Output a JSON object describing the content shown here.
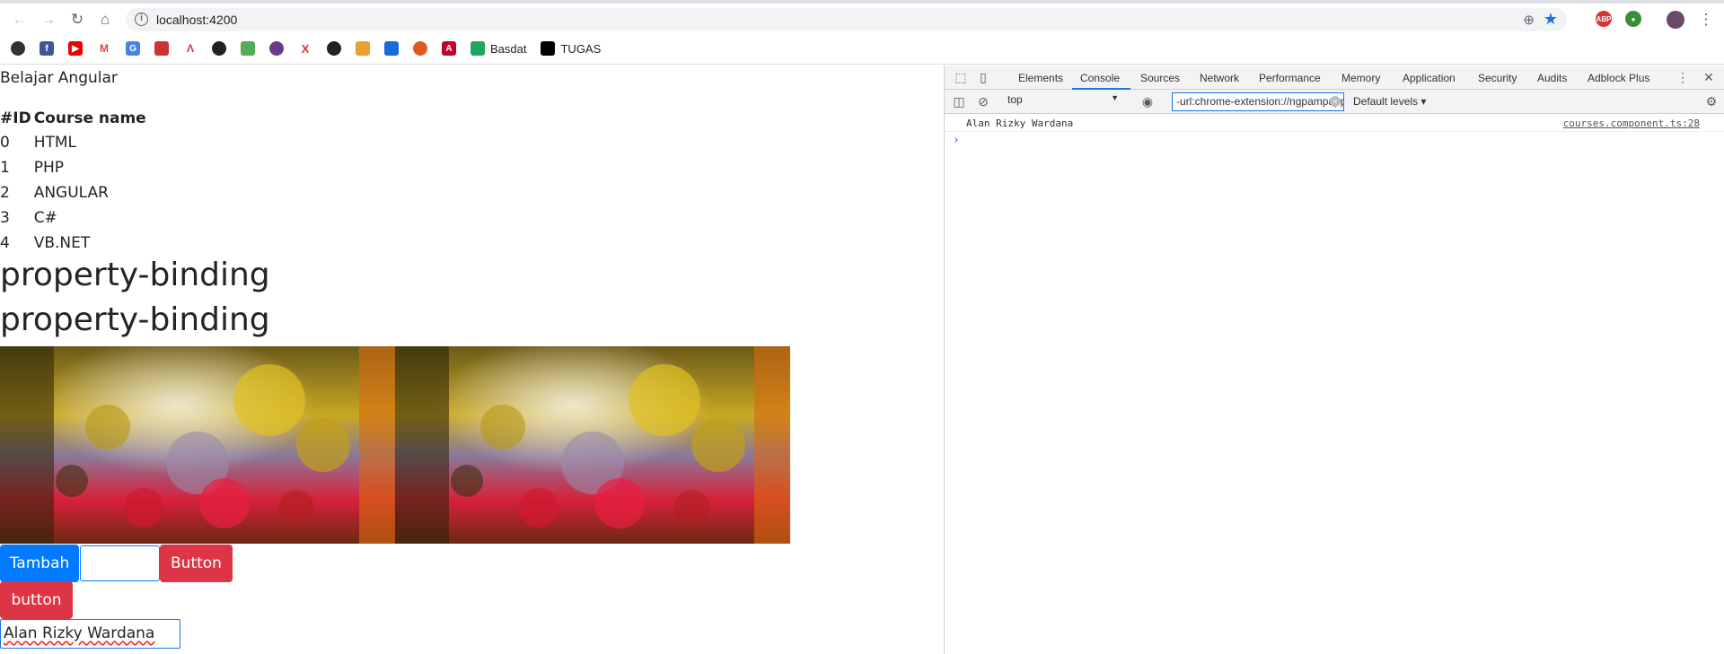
{
  "browser": {
    "url": "localhost:4200",
    "bookmarks": [
      {
        "name": "Basdat"
      },
      {
        "name": "TUGAS"
      }
    ]
  },
  "page": {
    "title": "Belajar Angular",
    "table": {
      "headers": [
        "#ID",
        "Course name"
      ],
      "rows": [
        [
          "0",
          "HTML"
        ],
        [
          "1",
          "PHP"
        ],
        [
          "2",
          "ANGULAR"
        ],
        [
          "3",
          "C#"
        ],
        [
          "4",
          "VB.NET"
        ]
      ]
    },
    "heading1": "property-binding",
    "heading2": "property-binding",
    "tambah_label": "Tambah",
    "button_label": "Button",
    "button2_label": "button",
    "name_value": "Alan Rizky Wardana"
  },
  "devtools": {
    "tabs": [
      "Elements",
      "Console",
      "Sources",
      "Network",
      "Performance",
      "Memory",
      "Application",
      "Security",
      "Audits",
      "Adblock Plus"
    ],
    "active_tab": "Console",
    "context": "top",
    "filter": "-url:chrome-extension://ngpampappnmepgilojfohadhhmbhlaek",
    "levels": "Default levels",
    "log_text": "Alan Rizky Wardana",
    "log_source": "courses.component.ts:28",
    "prompt": "›"
  },
  "colors": {
    "primary": "#007bff",
    "danger": "#dc3545",
    "devtools_accent": "#1a73e8"
  }
}
